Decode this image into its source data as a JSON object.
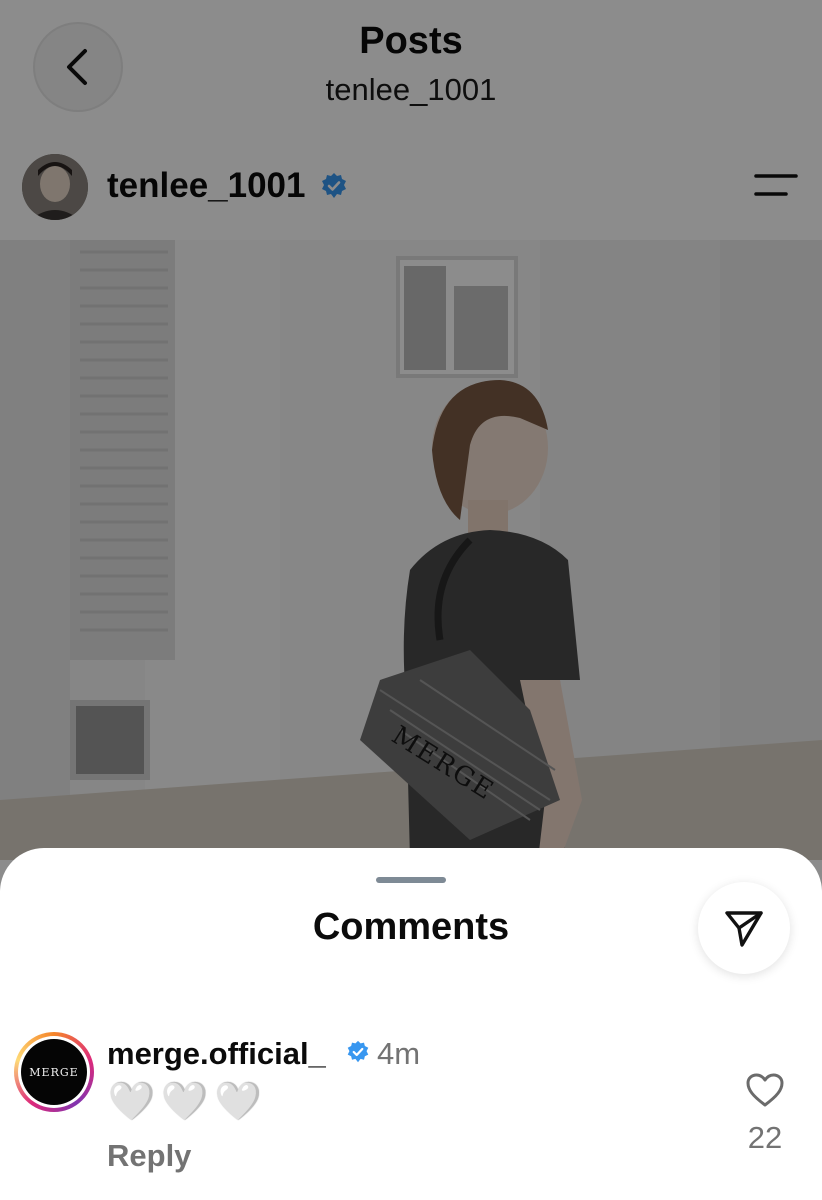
{
  "header": {
    "title": "Posts",
    "subtitle": "tenlee_1001",
    "back_icon": "chevron-left-icon"
  },
  "post": {
    "username": "tenlee_1001",
    "verified": true,
    "menu_icon": "menu-lines-icon",
    "bag_text": "MERGE"
  },
  "comments_sheet": {
    "title": "Comments",
    "share_icon": "send-icon",
    "comments": [
      {
        "username": "merge.official_",
        "verified": true,
        "time": "4m",
        "avatar_text": "MERGE",
        "text": "🤍🤍🤍",
        "hearts": [
          "🤍",
          "🤍",
          "🤍"
        ],
        "reply_label": "Reply",
        "like_count": "22"
      }
    ]
  },
  "colors": {
    "verified_blue": "#3897f0",
    "text_primary": "#0b0b0b",
    "text_secondary": "#737373"
  }
}
